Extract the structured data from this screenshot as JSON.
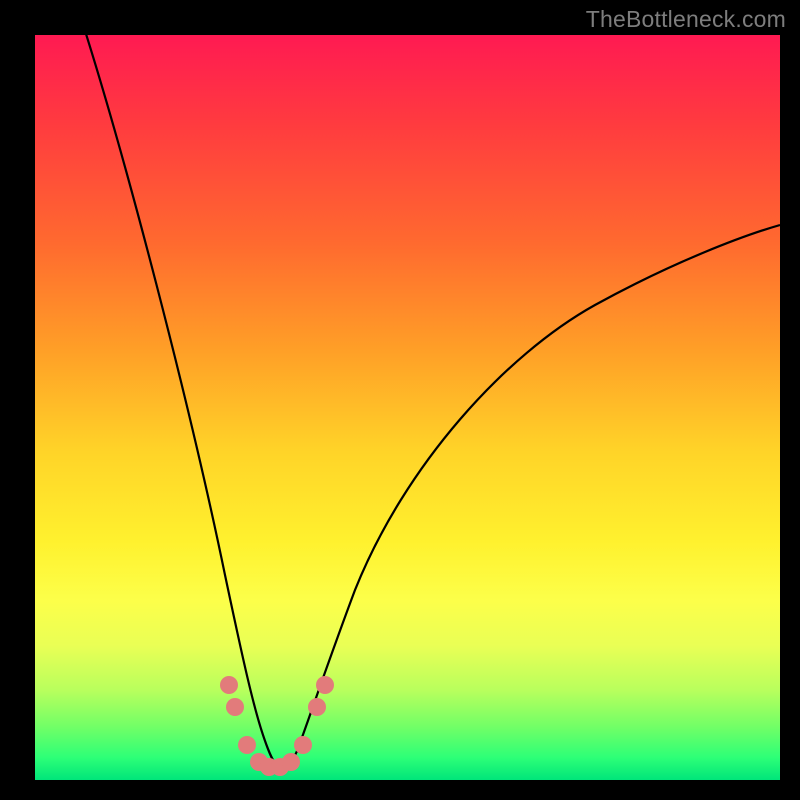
{
  "watermark": {
    "text": "TheBottleneck.com"
  },
  "chart_data": {
    "type": "line",
    "title": "",
    "xlabel": "",
    "ylabel": "",
    "xlim": [
      0,
      100
    ],
    "ylim": [
      0,
      100
    ],
    "grid": false,
    "series": [
      {
        "name": "bottleneck-curve",
        "x": [
          0,
          5,
          10,
          15,
          20,
          24,
          27,
          29,
          31,
          33,
          35,
          38,
          42,
          50,
          60,
          70,
          80,
          90,
          100
        ],
        "y": [
          102,
          85,
          68,
          51,
          34,
          18,
          9,
          4,
          2,
          2,
          4,
          9,
          18,
          34,
          48,
          58,
          66,
          72,
          76
        ]
      }
    ],
    "markers": {
      "name": "highlight-dots",
      "color": "#e27b7b",
      "radius_pct": 1.2,
      "points_xy": [
        [
          25.5,
          12.5
        ],
        [
          26.5,
          9.5
        ],
        [
          28.0,
          4.5
        ],
        [
          29.5,
          2.3
        ],
        [
          31.0,
          1.8
        ],
        [
          32.5,
          1.8
        ],
        [
          34.0,
          2.3
        ],
        [
          35.5,
          4.5
        ],
        [
          37.5,
          9.5
        ],
        [
          38.5,
          12.5
        ]
      ]
    },
    "gradient_bands": [
      {
        "label": "red",
        "y_pct": 100,
        "color": "#ff1a52"
      },
      {
        "label": "orange",
        "y_pct": 55,
        "color": "#ffb52a"
      },
      {
        "label": "yellow",
        "y_pct": 25,
        "color": "#fff633"
      },
      {
        "label": "green",
        "y_pct": 2,
        "color": "#00e57a"
      }
    ]
  }
}
